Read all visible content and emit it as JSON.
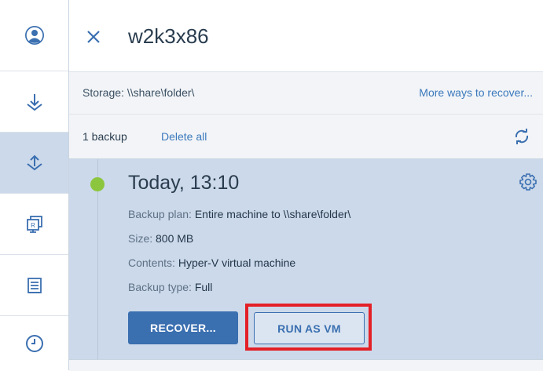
{
  "header": {
    "title": "w2k3x86"
  },
  "storage": {
    "label": "Storage:",
    "path": "\\\\share\\folder\\",
    "more_link": "More ways to recover..."
  },
  "backups_bar": {
    "count": "1 backup",
    "delete_all": "Delete all"
  },
  "backup": {
    "time": "Today, 13:10",
    "status_color": "#8cc63f",
    "details": [
      {
        "key": "Backup plan:",
        "value": "Entire machine to \\\\share\\folder\\"
      },
      {
        "key": "Size:",
        "value": "800 MB"
      },
      {
        "key": "Contents:",
        "value": "Hyper-V virtual machine"
      },
      {
        "key": "Backup type:",
        "value": "Full"
      }
    ],
    "recover_label": "RECOVER...",
    "run_vm_label": "RUN AS VM"
  },
  "sidebar": {
    "icons": [
      "user-icon",
      "download-icon",
      "upload-icon",
      "replica-icon",
      "report-icon",
      "clock-icon"
    ]
  },
  "colors": {
    "accent": "#3a6fb0",
    "selected_bg": "#ccd9ea",
    "highlight": "#e32027"
  }
}
